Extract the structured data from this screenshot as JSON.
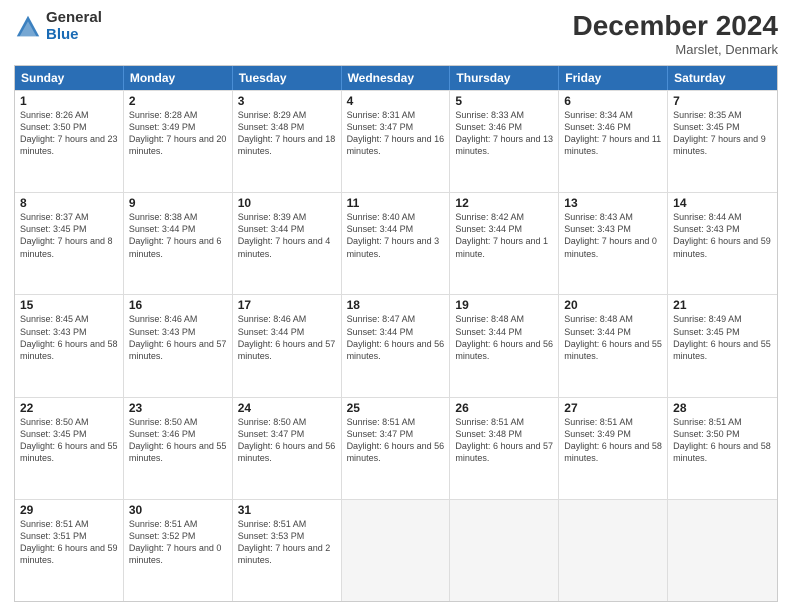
{
  "header": {
    "logo_general": "General",
    "logo_blue": "Blue",
    "title": "December 2024",
    "location": "Marslet, Denmark"
  },
  "weekdays": [
    "Sunday",
    "Monday",
    "Tuesday",
    "Wednesday",
    "Thursday",
    "Friday",
    "Saturday"
  ],
  "weeks": [
    [
      {
        "day": "1",
        "sunrise": "Sunrise: 8:26 AM",
        "sunset": "Sunset: 3:50 PM",
        "daylight": "Daylight: 7 hours and 23 minutes."
      },
      {
        "day": "2",
        "sunrise": "Sunrise: 8:28 AM",
        "sunset": "Sunset: 3:49 PM",
        "daylight": "Daylight: 7 hours and 20 minutes."
      },
      {
        "day": "3",
        "sunrise": "Sunrise: 8:29 AM",
        "sunset": "Sunset: 3:48 PM",
        "daylight": "Daylight: 7 hours and 18 minutes."
      },
      {
        "day": "4",
        "sunrise": "Sunrise: 8:31 AM",
        "sunset": "Sunset: 3:47 PM",
        "daylight": "Daylight: 7 hours and 16 minutes."
      },
      {
        "day": "5",
        "sunrise": "Sunrise: 8:33 AM",
        "sunset": "Sunset: 3:46 PM",
        "daylight": "Daylight: 7 hours and 13 minutes."
      },
      {
        "day": "6",
        "sunrise": "Sunrise: 8:34 AM",
        "sunset": "Sunset: 3:46 PM",
        "daylight": "Daylight: 7 hours and 11 minutes."
      },
      {
        "day": "7",
        "sunrise": "Sunrise: 8:35 AM",
        "sunset": "Sunset: 3:45 PM",
        "daylight": "Daylight: 7 hours and 9 minutes."
      }
    ],
    [
      {
        "day": "8",
        "sunrise": "Sunrise: 8:37 AM",
        "sunset": "Sunset: 3:45 PM",
        "daylight": "Daylight: 7 hours and 8 minutes."
      },
      {
        "day": "9",
        "sunrise": "Sunrise: 8:38 AM",
        "sunset": "Sunset: 3:44 PM",
        "daylight": "Daylight: 7 hours and 6 minutes."
      },
      {
        "day": "10",
        "sunrise": "Sunrise: 8:39 AM",
        "sunset": "Sunset: 3:44 PM",
        "daylight": "Daylight: 7 hours and 4 minutes."
      },
      {
        "day": "11",
        "sunrise": "Sunrise: 8:40 AM",
        "sunset": "Sunset: 3:44 PM",
        "daylight": "Daylight: 7 hours and 3 minutes."
      },
      {
        "day": "12",
        "sunrise": "Sunrise: 8:42 AM",
        "sunset": "Sunset: 3:44 PM",
        "daylight": "Daylight: 7 hours and 1 minute."
      },
      {
        "day": "13",
        "sunrise": "Sunrise: 8:43 AM",
        "sunset": "Sunset: 3:43 PM",
        "daylight": "Daylight: 7 hours and 0 minutes."
      },
      {
        "day": "14",
        "sunrise": "Sunrise: 8:44 AM",
        "sunset": "Sunset: 3:43 PM",
        "daylight": "Daylight: 6 hours and 59 minutes."
      }
    ],
    [
      {
        "day": "15",
        "sunrise": "Sunrise: 8:45 AM",
        "sunset": "Sunset: 3:43 PM",
        "daylight": "Daylight: 6 hours and 58 minutes."
      },
      {
        "day": "16",
        "sunrise": "Sunrise: 8:46 AM",
        "sunset": "Sunset: 3:43 PM",
        "daylight": "Daylight: 6 hours and 57 minutes."
      },
      {
        "day": "17",
        "sunrise": "Sunrise: 8:46 AM",
        "sunset": "Sunset: 3:44 PM",
        "daylight": "Daylight: 6 hours and 57 minutes."
      },
      {
        "day": "18",
        "sunrise": "Sunrise: 8:47 AM",
        "sunset": "Sunset: 3:44 PM",
        "daylight": "Daylight: 6 hours and 56 minutes."
      },
      {
        "day": "19",
        "sunrise": "Sunrise: 8:48 AM",
        "sunset": "Sunset: 3:44 PM",
        "daylight": "Daylight: 6 hours and 56 minutes."
      },
      {
        "day": "20",
        "sunrise": "Sunrise: 8:48 AM",
        "sunset": "Sunset: 3:44 PM",
        "daylight": "Daylight: 6 hours and 55 minutes."
      },
      {
        "day": "21",
        "sunrise": "Sunrise: 8:49 AM",
        "sunset": "Sunset: 3:45 PM",
        "daylight": "Daylight: 6 hours and 55 minutes."
      }
    ],
    [
      {
        "day": "22",
        "sunrise": "Sunrise: 8:50 AM",
        "sunset": "Sunset: 3:45 PM",
        "daylight": "Daylight: 6 hours and 55 minutes."
      },
      {
        "day": "23",
        "sunrise": "Sunrise: 8:50 AM",
        "sunset": "Sunset: 3:46 PM",
        "daylight": "Daylight: 6 hours and 55 minutes."
      },
      {
        "day": "24",
        "sunrise": "Sunrise: 8:50 AM",
        "sunset": "Sunset: 3:47 PM",
        "daylight": "Daylight: 6 hours and 56 minutes."
      },
      {
        "day": "25",
        "sunrise": "Sunrise: 8:51 AM",
        "sunset": "Sunset: 3:47 PM",
        "daylight": "Daylight: 6 hours and 56 minutes."
      },
      {
        "day": "26",
        "sunrise": "Sunrise: 8:51 AM",
        "sunset": "Sunset: 3:48 PM",
        "daylight": "Daylight: 6 hours and 57 minutes."
      },
      {
        "day": "27",
        "sunrise": "Sunrise: 8:51 AM",
        "sunset": "Sunset: 3:49 PM",
        "daylight": "Daylight: 6 hours and 58 minutes."
      },
      {
        "day": "28",
        "sunrise": "Sunrise: 8:51 AM",
        "sunset": "Sunset: 3:50 PM",
        "daylight": "Daylight: 6 hours and 58 minutes."
      }
    ],
    [
      {
        "day": "29",
        "sunrise": "Sunrise: 8:51 AM",
        "sunset": "Sunset: 3:51 PM",
        "daylight": "Daylight: 6 hours and 59 minutes."
      },
      {
        "day": "30",
        "sunrise": "Sunrise: 8:51 AM",
        "sunset": "Sunset: 3:52 PM",
        "daylight": "Daylight: 7 hours and 0 minutes."
      },
      {
        "day": "31",
        "sunrise": "Sunrise: 8:51 AM",
        "sunset": "Sunset: 3:53 PM",
        "daylight": "Daylight: 7 hours and 2 minutes."
      },
      {
        "day": "",
        "sunrise": "",
        "sunset": "",
        "daylight": ""
      },
      {
        "day": "",
        "sunrise": "",
        "sunset": "",
        "daylight": ""
      },
      {
        "day": "",
        "sunrise": "",
        "sunset": "",
        "daylight": ""
      },
      {
        "day": "",
        "sunrise": "",
        "sunset": "",
        "daylight": ""
      }
    ]
  ]
}
